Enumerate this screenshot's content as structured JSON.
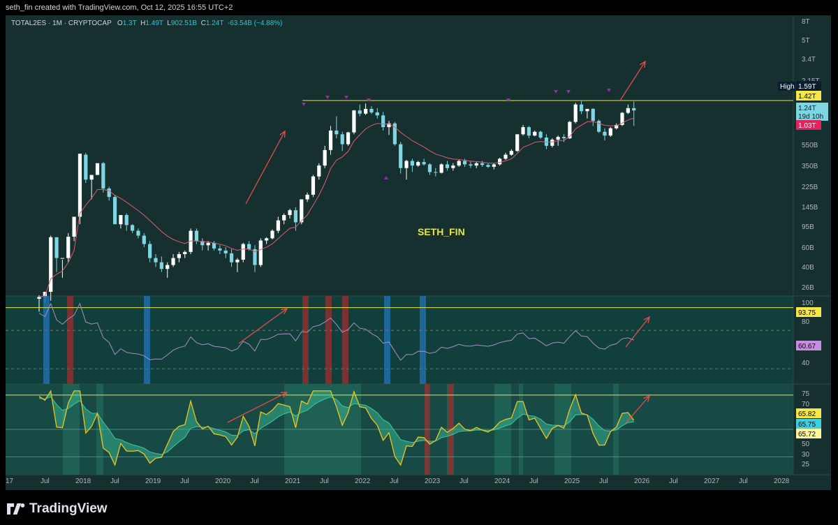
{
  "header": {
    "attribution": "seth_fin created with TradingView.com, Oct 12, 2025 16:55 UTC+2"
  },
  "legend": {
    "symbol": "TOTAL2ES · 1M · CRYPTOCAP",
    "o_label": "O",
    "o_value": "1.3T",
    "h_label": "H",
    "h_value": "1.49T",
    "l_label": "L",
    "l_value": "902.51B",
    "c_label": "C",
    "c_value": "1.24T",
    "change": "-63.54B (−4.88%)"
  },
  "watermark": "SETH_FIN",
  "price_axis": {
    "ticks": [
      "8T",
      "5T",
      "3.4T",
      "2.15T",
      "550B",
      "350B",
      "225B",
      "145B",
      "95B",
      "60B",
      "40B",
      "26B"
    ],
    "high_label": "High",
    "high_value": "1.59T",
    "level_value": "1.42T",
    "current_value": "1.24T",
    "countdown": "19d 10h",
    "low_value": "1.03T"
  },
  "rsi_axis": {
    "ticks": [
      "100",
      "80",
      "40"
    ],
    "level_value": "93.75",
    "current_value": "60.67"
  },
  "osc_axis": {
    "ticks": [
      "75",
      "70",
      "50",
      "30",
      "25"
    ],
    "values": [
      "65.82",
      "65.75",
      "65.72"
    ]
  },
  "time_axis": {
    "labels": [
      "17",
      "Jul",
      "2018",
      "Jul",
      "2019",
      "Jul",
      "2020",
      "Jul",
      "2021",
      "Jul",
      "2022",
      "Jul",
      "2023",
      "Jul",
      "2024",
      "Jul",
      "2025",
      "Jul",
      "2026",
      "Jul",
      "2027",
      "Jul",
      "2028"
    ]
  },
  "brand": {
    "name": "TradingView"
  },
  "colors": {
    "background": "#15302e",
    "bull_candle": "#ffffff",
    "bear_candle": "#7fd6e3",
    "ema": "#e05a6e",
    "level_line": "#e6e64a",
    "rsi_line": "#a58fc7",
    "osc_fast": "#f0c419",
    "osc_slow": "#3fc7a0",
    "arrow": "#e84a4a",
    "marker": "#9c27b0"
  },
  "chart_data": {
    "type": "candlestick",
    "timeframe": "1M",
    "y_scale": "log",
    "price_range": [
      26000000000.0,
      8000000000000.0
    ],
    "months_from": "2017-04",
    "candles": [
      [
        26,
        28,
        20,
        27
      ],
      [
        27,
        29,
        24,
        30
      ],
      [
        30,
        95,
        25,
        92
      ],
      [
        92,
        90,
        45,
        60
      ],
      [
        60,
        58,
        40,
        60
      ],
      [
        60,
        100,
        55,
        93
      ],
      [
        93,
        95,
        85,
        140
      ],
      [
        140,
        500,
        120,
        510
      ],
      [
        500,
        520,
        280,
        300
      ],
      [
        300,
        310,
        200,
        330
      ],
      [
        330,
        400,
        330,
        420
      ],
      [
        420,
        430,
        230,
        250
      ],
      [
        250,
        260,
        195,
        210
      ],
      [
        210,
        220,
        130,
        120
      ],
      [
        120,
        125,
        110,
        145
      ],
      [
        145,
        150,
        105,
        118
      ],
      [
        118,
        120,
        100,
        105
      ],
      [
        105,
        110,
        90,
        95
      ],
      [
        95,
        100,
        75,
        80
      ],
      [
        80,
        85,
        55,
        60
      ],
      [
        60,
        65,
        50,
        55
      ],
      [
        55,
        62,
        45,
        48
      ],
      [
        48,
        55,
        40,
        52
      ],
      [
        52,
        65,
        50,
        60
      ],
      [
        60,
        68,
        55,
        65
      ],
      [
        65,
        70,
        60,
        68
      ],
      [
        68,
        110,
        65,
        105
      ],
      [
        105,
        110,
        80,
        85
      ],
      [
        85,
        90,
        70,
        78
      ],
      [
        78,
        85,
        70,
        82
      ],
      [
        82,
        85,
        70,
        73
      ],
      [
        73,
        78,
        65,
        70
      ],
      [
        70,
        75,
        60,
        66
      ],
      [
        66,
        72,
        50,
        55
      ],
      [
        55,
        60,
        45,
        58
      ],
      [
        58,
        82,
        55,
        80
      ],
      [
        80,
        85,
        70,
        72
      ],
      [
        72,
        78,
        45,
        52
      ],
      [
        52,
        90,
        50,
        86
      ],
      [
        86,
        92,
        80,
        90
      ],
      [
        90,
        108,
        88,
        105
      ],
      [
        105,
        140,
        100,
        130
      ],
      [
        130,
        150,
        120,
        145
      ],
      [
        145,
        165,
        135,
        160
      ],
      [
        160,
        170,
        105,
        125
      ],
      [
        125,
        160,
        120,
        200
      ],
      [
        200,
        230,
        190,
        220
      ],
      [
        220,
        330,
        210,
        320
      ],
      [
        320,
        420,
        300,
        400
      ],
      [
        400,
        600,
        380,
        550
      ],
      [
        550,
        900,
        500,
        820
      ],
      [
        820,
        1100,
        700,
        760
      ],
      [
        760,
        800,
        540,
        620
      ],
      [
        620,
        800,
        600,
        790
      ],
      [
        790,
        1250,
        760,
        1240
      ],
      [
        1240,
        1400,
        1100,
        1160
      ],
      [
        1160,
        1430,
        1130,
        1280
      ],
      [
        1280,
        1350,
        1150,
        1190
      ],
      [
        1190,
        1300,
        1050,
        1120
      ],
      [
        1120,
        1200,
        820,
        880
      ],
      [
        880,
        1000,
        750,
        950
      ],
      [
        950,
        980,
        600,
        620
      ],
      [
        620,
        650,
        340,
        380
      ],
      [
        380,
        450,
        300,
        440
      ],
      [
        440,
        460,
        350,
        400
      ],
      [
        400,
        440,
        390,
        430
      ],
      [
        430,
        460,
        400,
        410
      ],
      [
        410,
        420,
        330,
        350
      ],
      [
        350,
        380,
        320,
        345
      ],
      [
        345,
        420,
        340,
        410
      ],
      [
        410,
        440,
        360,
        380
      ],
      [
        380,
        420,
        360,
        400
      ],
      [
        400,
        450,
        390,
        440
      ],
      [
        440,
        460,
        390,
        410
      ],
      [
        410,
        440,
        380,
        400
      ],
      [
        400,
        430,
        380,
        420
      ],
      [
        420,
        440,
        390,
        405
      ],
      [
        405,
        420,
        380,
        390
      ],
      [
        390,
        420,
        370,
        410
      ],
      [
        410,
        470,
        400,
        460
      ],
      [
        460,
        520,
        450,
        500
      ],
      [
        500,
        560,
        490,
        540
      ],
      [
        540,
        760,
        530,
        760
      ],
      [
        760,
        920,
        740,
        880
      ],
      [
        880,
        900,
        700,
        740
      ],
      [
        740,
        820,
        730,
        800
      ],
      [
        800,
        820,
        690,
        710
      ],
      [
        710,
        760,
        560,
        600
      ],
      [
        600,
        700,
        580,
        680
      ],
      [
        680,
        740,
        600,
        720
      ],
      [
        720,
        760,
        650,
        700
      ],
      [
        700,
        1000,
        690,
        980
      ],
      [
        980,
        1450,
        950,
        1400
      ],
      [
        1400,
        1500,
        1150,
        1220
      ],
      [
        1220,
        1260,
        1050,
        1280
      ],
      [
        1280,
        1300,
        900,
        1000
      ],
      [
        1000,
        1030,
        780,
        800
      ],
      [
        800,
        860,
        670,
        740
      ],
      [
        740,
        880,
        720,
        860
      ],
      [
        860,
        950,
        840,
        920
      ],
      [
        920,
        1200,
        900,
        1180
      ],
      [
        1180,
        1400,
        1150,
        1300
      ],
      [
        1300,
        1490,
        902,
        1240
      ]
    ],
    "levels": [
      {
        "value_t": 1.42,
        "label": "1.42T"
      }
    ],
    "rsi": {
      "level": 93.75,
      "current": 60.67
    },
    "oscillator": {
      "values": [
        65.82,
        65.75,
        65.72
      ],
      "bands": [
        75,
        70,
        50,
        30,
        25
      ]
    }
  }
}
